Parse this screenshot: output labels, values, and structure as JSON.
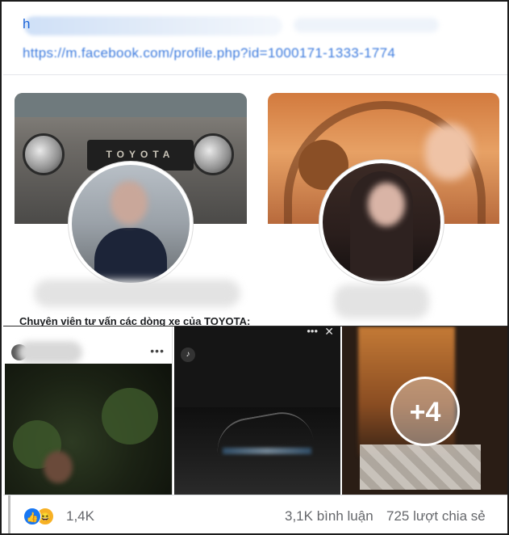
{
  "link": {
    "heading_fragment": "h",
    "url": "https://m.facebook.com/profile.php?id=1000171-1333-1774"
  },
  "profiles": {
    "left": {
      "cover_brand": "TOYOTA",
      "description": "Chuyên viên tư vấn các dòng xe của TOYOTA:"
    }
  },
  "media": {
    "video_dots": "•••",
    "video_close": "✕",
    "more_count": "+4"
  },
  "footer": {
    "reaction_count": "1,4K",
    "comments": "3,1K bình luận",
    "shares": "725 lượt chia sẻ"
  }
}
